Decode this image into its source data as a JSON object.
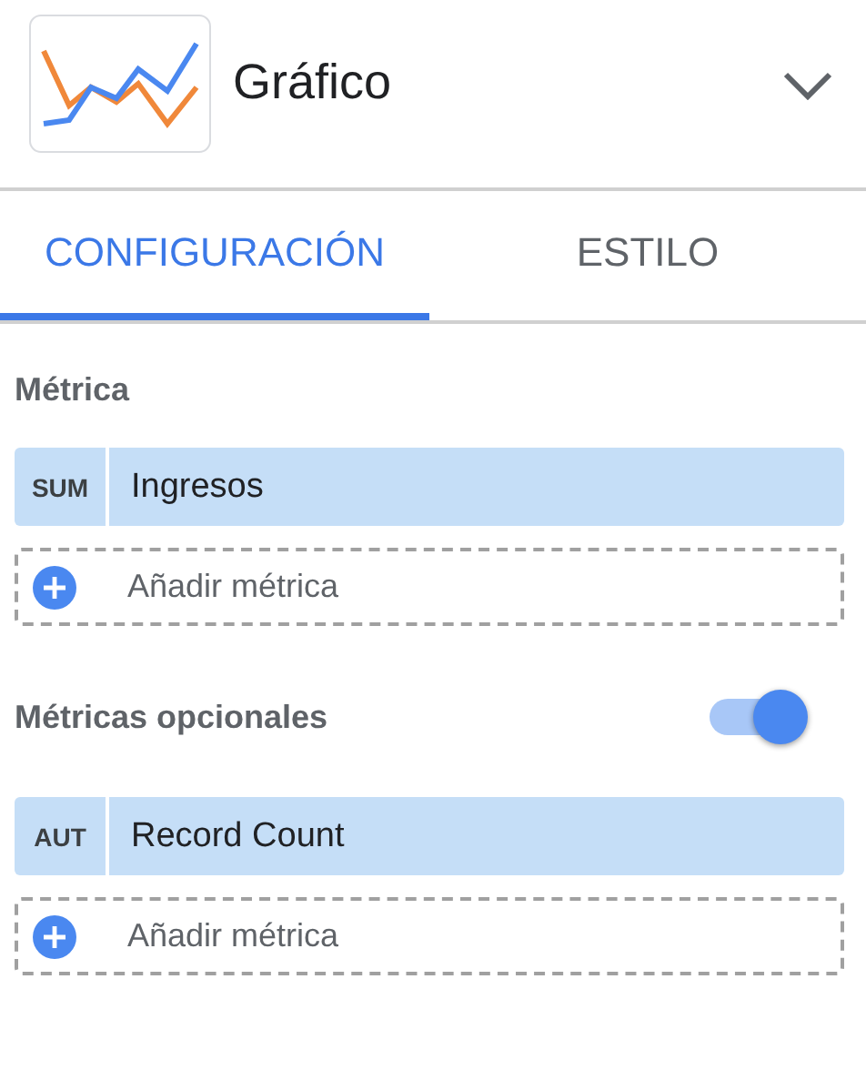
{
  "header": {
    "title": "Gráfico"
  },
  "tabs": [
    {
      "label": "CONFIGURACIÓN",
      "selected": true
    },
    {
      "label": "ESTILO",
      "selected": false
    }
  ],
  "sections": [
    {
      "label": "Métrica",
      "metrics": [
        {
          "aggregation": "SUM",
          "name": "Ingresos"
        }
      ],
      "add_label": "Añadir métrica"
    },
    {
      "label": "Métricas opcionales",
      "toggle": {
        "on": true
      },
      "metrics": [
        {
          "aggregation": "AUT",
          "name": "Record Count"
        }
      ],
      "add_label": "Añadir métrica"
    }
  ]
}
